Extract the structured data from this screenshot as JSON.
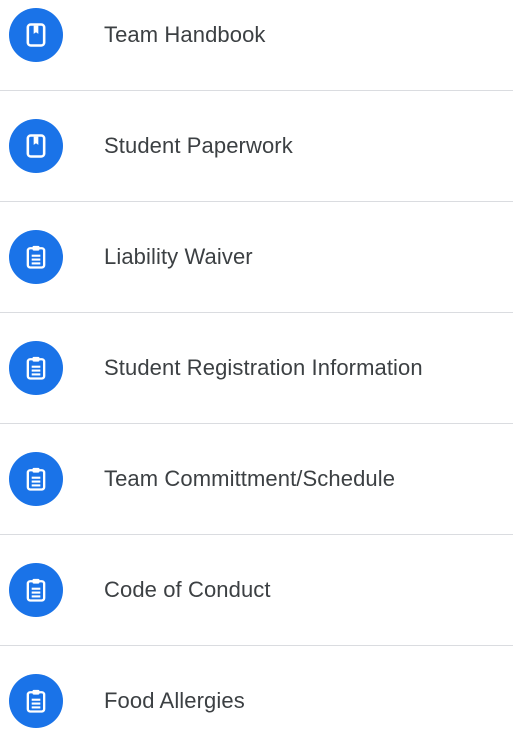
{
  "colors": {
    "icon_background": "#1a73e8",
    "icon_foreground": "#ffffff",
    "label_text": "#3c4043",
    "divider": "#dadce0"
  },
  "items": [
    {
      "label": "Team Handbook",
      "icon": "book-icon"
    },
    {
      "label": "Student Paperwork",
      "icon": "book-icon"
    },
    {
      "label": "Liability Waiver",
      "icon": "clipboard-icon"
    },
    {
      "label": "Student Registration Information",
      "icon": "clipboard-icon"
    },
    {
      "label": "Team Committment/Schedule",
      "icon": "clipboard-icon"
    },
    {
      "label": "Code of Conduct",
      "icon": "clipboard-icon"
    },
    {
      "label": "Food Allergies",
      "icon": "clipboard-icon"
    }
  ]
}
